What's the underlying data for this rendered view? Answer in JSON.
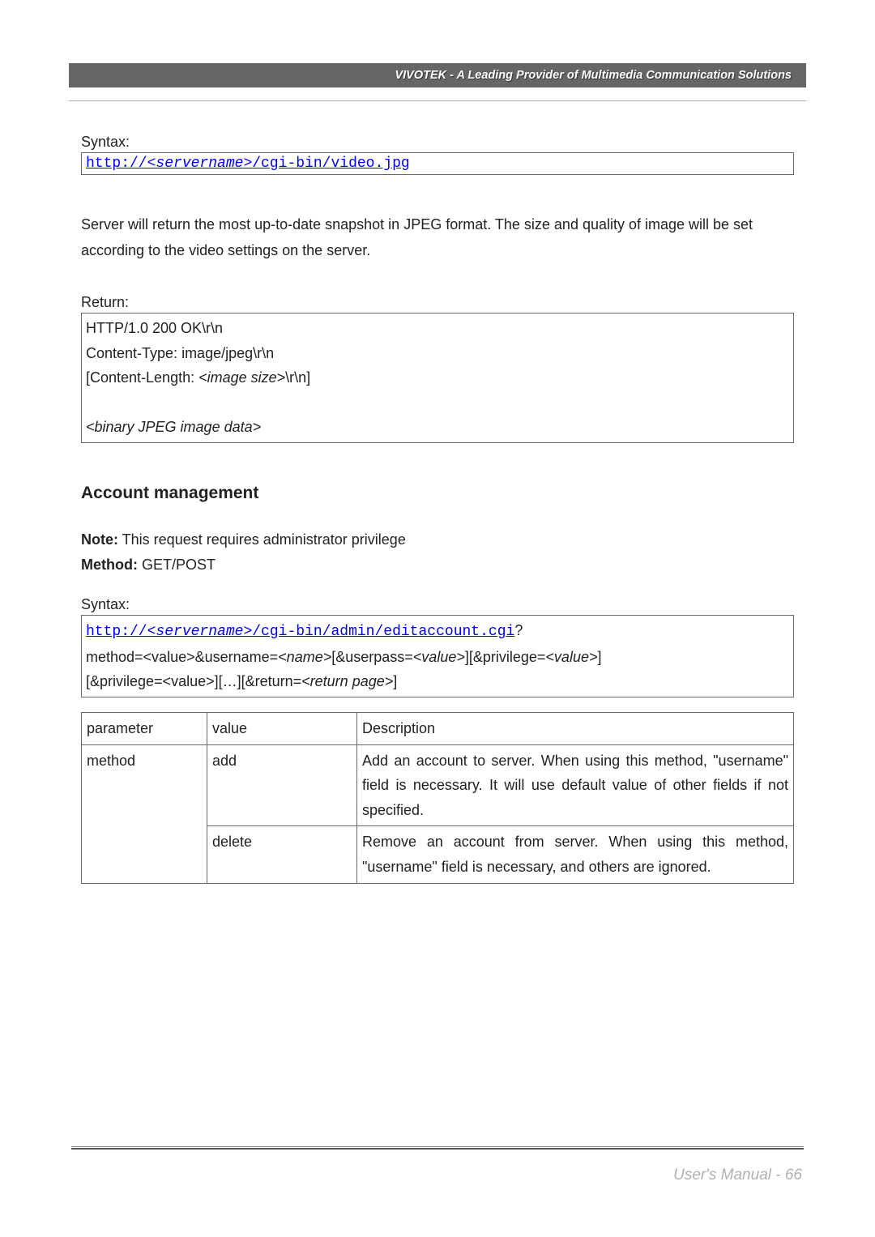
{
  "header": {
    "text": "VIVOTEK - A Leading Provider of Multimedia Communication Solutions"
  },
  "section1": {
    "syntax_label": "Syntax:",
    "url_pre": "http://",
    "url_server": "<servername>",
    "url_post": "/cgi-bin/video.jpg",
    "desc": "Server will return the most up-to-date snapshot in JPEG format. The size and quality of image will be set according to the video settings on the server.",
    "return_label": "Return:",
    "return_lines": {
      "l1": "HTTP/1.0 200 OK\\r\\n",
      "l2": "Content-Type: image/jpeg\\r\\n",
      "l3a": "[Content-Length: ",
      "l3b": "<image size>",
      "l3c": "\\r\\n]",
      "l4": "<binary JPEG image data>"
    }
  },
  "section2": {
    "title": "Account management",
    "note_label": "Note:",
    "note_text": " This request requires administrator privilege",
    "method_label": "Method:",
    "method_text": " GET/POST",
    "syntax_label": "Syntax:",
    "url_pre": "http://",
    "url_server": "<servername>",
    "url_post": "/cgi-bin/admin/editaccount.cgi",
    "qmark": "?",
    "line2a": "method=<value>&username=",
    "line2b": "<name>",
    "line2c": "[&userpass=",
    "line2d": "<value>",
    "line2e": "][&privilege=",
    "line2f": "<value>",
    "line2g": "]",
    "line3a": "[&privilege=<value>][…][&return=",
    "line3b": "<return page>",
    "line3c": "]"
  },
  "table": {
    "h1": "parameter",
    "h2": "value",
    "h3": "Description",
    "r1c1": "method",
    "r1c2": "add",
    "r1c3": "Add an account to server. When using this method, \"username\" field is necessary. It will use default value of other fields if not specified.",
    "r2c2": "delete",
    "r2c3": "Remove an account from server. When using this method, \"username\" field is necessary, and others are ignored."
  },
  "footer": {
    "text": "User's Manual - 66"
  }
}
